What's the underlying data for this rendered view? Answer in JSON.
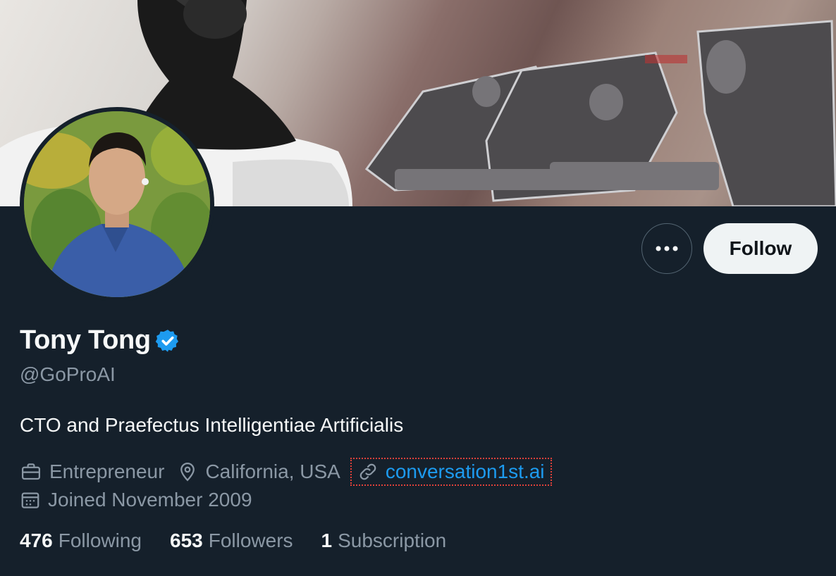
{
  "profile": {
    "display_name": "Tony Tong",
    "handle": "@GoProAI",
    "bio": "CTO and Praefectus Intelligentiae Artificialis",
    "category": "Entrepreneur",
    "location": "California, USA",
    "website": "conversation1st.ai",
    "joined": "Joined November 2009",
    "verified": true
  },
  "actions": {
    "more_icon": "more-horizontal-icon",
    "follow_label": "Follow"
  },
  "stats": {
    "following_count": "476",
    "following_label": "Following",
    "followers_count": "653",
    "followers_label": "Followers",
    "subscription_count": "1",
    "subscription_label": "Subscription"
  },
  "colors": {
    "background": "#15202b",
    "accent": "#1d9bf0",
    "muted_text": "#8b98a5",
    "highlight_box": "#e0413a"
  }
}
